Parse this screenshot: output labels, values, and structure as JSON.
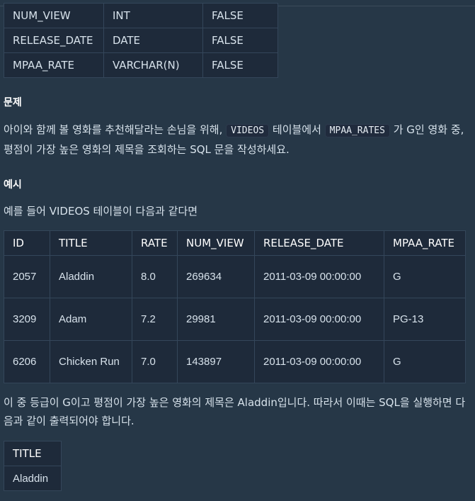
{
  "schema_table": {
    "rows": [
      [
        "NUM_VIEW",
        "INT",
        "FALSE"
      ],
      [
        "RELEASE_DATE",
        "DATE",
        "FALSE"
      ],
      [
        "MPAA_RATE",
        "VARCHAR(N)",
        "FALSE"
      ]
    ]
  },
  "problem": {
    "heading": "문제",
    "text_part1": "아이와 함께 볼 영화를 추천해달라는 손님을 위해, ",
    "code1": "VIDEOS",
    "text_part2": " 테이블에서 ",
    "code2": "MPAA_RATES",
    "text_part3": " 가 G인 영화 중, 평점이 가장 높은 영화의 제목을 조회하는 SQL 문을 작성하세요."
  },
  "example": {
    "heading": "예시",
    "intro": "예를 들어 VIDEOS 테이블이 다음과 같다면",
    "headers": [
      "ID",
      "TITLE",
      "RATE",
      "NUM_VIEW",
      "RELEASE_DATE",
      "MPAA_RATE"
    ],
    "rows": [
      [
        "2057",
        "Aladdin",
        "8.0",
        "269634",
        "2011-03-09 00:00:00",
        "G"
      ],
      [
        "3209",
        "Adam",
        "7.2",
        "29981",
        "2011-03-09 00:00:00",
        "PG-13"
      ],
      [
        "6206",
        "Chicken Run",
        "7.0",
        "143897",
        "2011-03-09 00:00:00",
        "G"
      ]
    ],
    "explanation": "이 중 등급이 G이고 평점이 가장 높은 영화의 제목은 Aladdin입니다. 따라서 이때는 SQL을 실행하면 다음과 같이 출력되어야 합니다."
  },
  "result_table": {
    "headers": [
      "TITLE"
    ],
    "rows": [
      [
        "Aladdin"
      ]
    ]
  }
}
